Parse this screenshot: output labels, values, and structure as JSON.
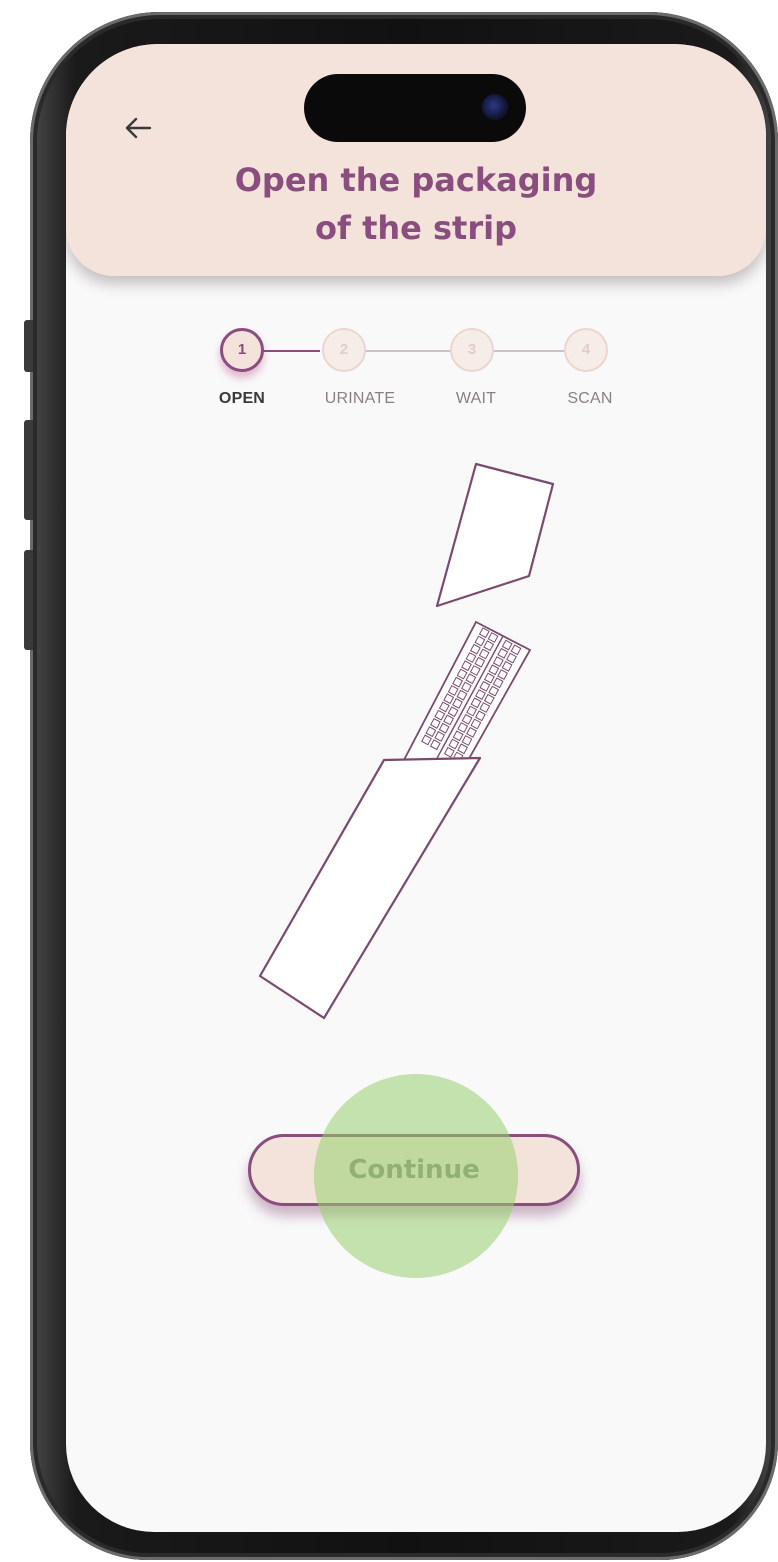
{
  "header": {
    "title": "Open the packaging\nof the strip",
    "back_icon": "arrow-left-icon"
  },
  "stepper": {
    "steps": [
      {
        "number": "1",
        "label": "OPEN",
        "active": true
      },
      {
        "number": "2",
        "label": "URINATE",
        "active": false
      },
      {
        "number": "3",
        "label": "WAIT",
        "active": false
      },
      {
        "number": "4",
        "label": "SCAN",
        "active": false
      }
    ]
  },
  "actions": {
    "continue_label": "Continue"
  },
  "colors": {
    "accent": "#8a4e7e",
    "header_bg": "#f3e3db",
    "touch": "#97d06e"
  }
}
